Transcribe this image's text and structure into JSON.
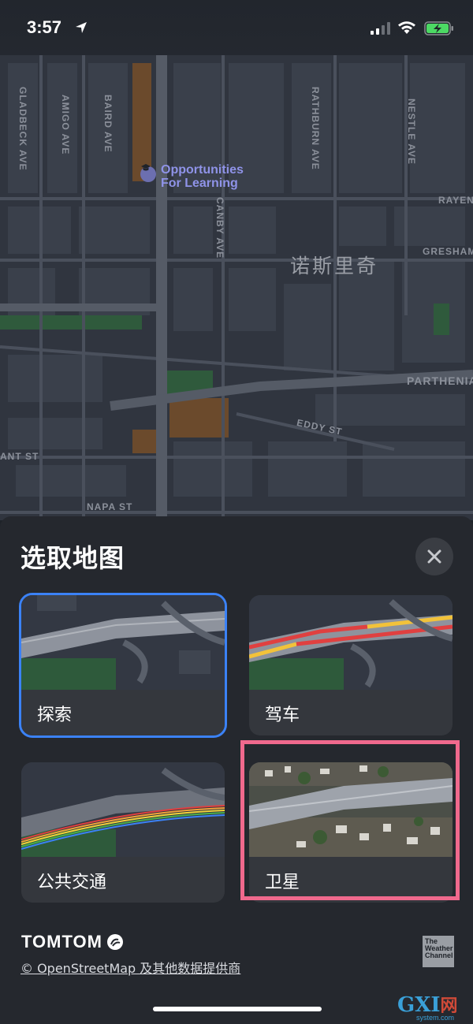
{
  "status_bar": {
    "time": "3:57",
    "icons": [
      "location-arrow-icon",
      "cellular-signal-icon",
      "wifi-icon",
      "battery-charging-icon"
    ]
  },
  "map": {
    "street_labels": {
      "gladbeck": "GLADBECK AVE",
      "amigo": "AMIGO AVE",
      "baird": "BAIRD AVE",
      "rathburn": "RATHBURN AVE",
      "nestle": "NESTLE AVE",
      "canby": "CANBY AVE",
      "rayen": "RAYEN",
      "gresham": "GRESHAM",
      "parthenia": "PARTHENIA",
      "eddy": "EDDY ST",
      "ant": "ANT ST",
      "napa": "NAPA ST"
    },
    "poi": {
      "line1": "Opportunities",
      "line2": "For Learning",
      "icon": "graduation-cap-icon"
    },
    "area_label": "诺斯里奇"
  },
  "sheet": {
    "title": "选取地图",
    "close_icon": "close-icon",
    "cards": [
      {
        "label": "探索",
        "selected": true
      },
      {
        "label": "驾车",
        "selected": false
      },
      {
        "label": "公共交通",
        "selected": false
      },
      {
        "label": "卫星",
        "selected": false
      }
    ],
    "brand": "TOMTOM",
    "attribution": "© OpenStreetMap 及其他数据提供商",
    "weather_logo": {
      "line1": "The",
      "line2": "Weather",
      "line3": "Channel"
    }
  },
  "watermark": {
    "brand": "GXI",
    "net": "网",
    "domain": "system.com"
  },
  "colors": {
    "accent_blue": "#3b82f6",
    "highlight_pink": "#f0698d",
    "sheet_bg": "#25282e",
    "map_bg": "#30353f"
  }
}
